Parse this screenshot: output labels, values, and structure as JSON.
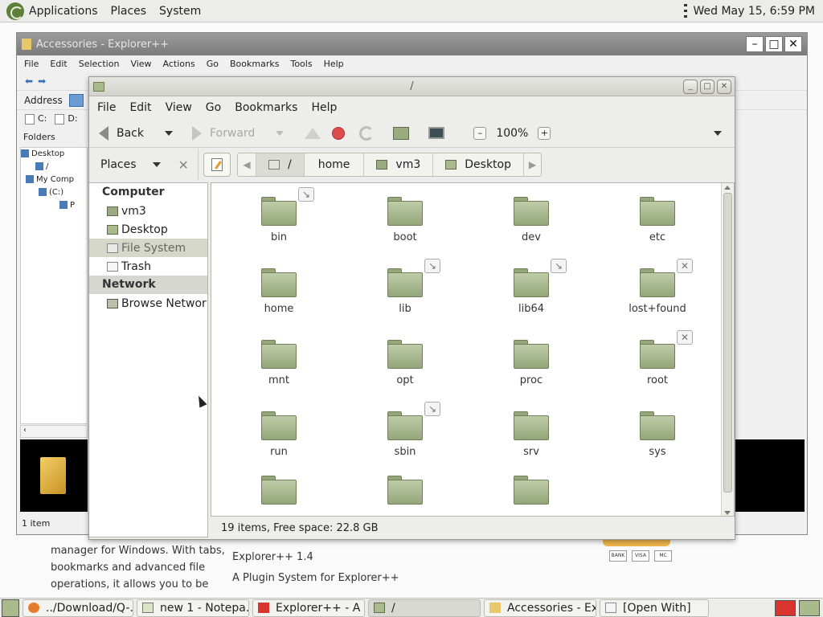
{
  "top_panel": {
    "menus": [
      "Applications",
      "Places",
      "System"
    ],
    "clock": "Wed May 15,  6:59 PM"
  },
  "background_page": {
    "text_lines": [
      "manager for Windows. With tabs,",
      "bookmarks and advanced file",
      "operations, it allows you to be"
    ],
    "links": [
      "Explorer++ 1.4",
      "A Plugin System for Explorer++"
    ],
    "pay_icons": [
      "BANK",
      "VISA",
      "MC"
    ]
  },
  "explorer_window": {
    "title": "Accessories - Explorer++",
    "menu": [
      "File",
      "Edit",
      "Selection",
      "View",
      "Actions",
      "Go",
      "Bookmarks",
      "Tools",
      "Help"
    ],
    "address_label": "Address",
    "drives": [
      "C:",
      "D:"
    ],
    "folders_label": "Folders",
    "tree": [
      "Desktop",
      "/",
      "My Comp",
      "(C:)",
      "P"
    ],
    "status": "1 item"
  },
  "nautilus": {
    "title": "/",
    "menu": [
      "File",
      "Edit",
      "View",
      "Go",
      "Bookmarks",
      "Help"
    ],
    "toolbar": {
      "back": "Back",
      "forward": "Forward",
      "zoom": "100%",
      "zoom_out": "–",
      "zoom_in": "+"
    },
    "places_combo": "Places",
    "breadcrumbs": [
      "/",
      "home",
      "vm3",
      "Desktop"
    ],
    "sidebar": {
      "computer_header": "Computer",
      "computer_items": [
        "vm3",
        "Desktop",
        "File System",
        "Trash"
      ],
      "network_header": "Network",
      "network_items": [
        "Browse Network"
      ]
    },
    "files": [
      {
        "name": "bin",
        "badge": "↘"
      },
      {
        "name": "boot",
        "badge": ""
      },
      {
        "name": "dev",
        "badge": ""
      },
      {
        "name": "etc",
        "badge": ""
      },
      {
        "name": "home",
        "badge": ""
      },
      {
        "name": "lib",
        "badge": "↘"
      },
      {
        "name": "lib64",
        "badge": "↘"
      },
      {
        "name": "lost+found",
        "badge": "✕"
      },
      {
        "name": "mnt",
        "badge": ""
      },
      {
        "name": "opt",
        "badge": ""
      },
      {
        "name": "proc",
        "badge": ""
      },
      {
        "name": "root",
        "badge": "✕"
      },
      {
        "name": "run",
        "badge": ""
      },
      {
        "name": "sbin",
        "badge": "↘"
      },
      {
        "name": "srv",
        "badge": ""
      },
      {
        "name": "sys",
        "badge": ""
      },
      {
        "name": "",
        "badge": ""
      },
      {
        "name": "",
        "badge": ""
      },
      {
        "name": "",
        "badge": ""
      }
    ],
    "status": "19 items, Free space: 22.8 GB"
  },
  "taskbar": {
    "tasks": [
      "../Download/Q-...",
      "new 1 - Notepa...",
      "Explorer++ - A s...",
      "/",
      "Accessories - Ex...",
      "[Open With]"
    ]
  }
}
